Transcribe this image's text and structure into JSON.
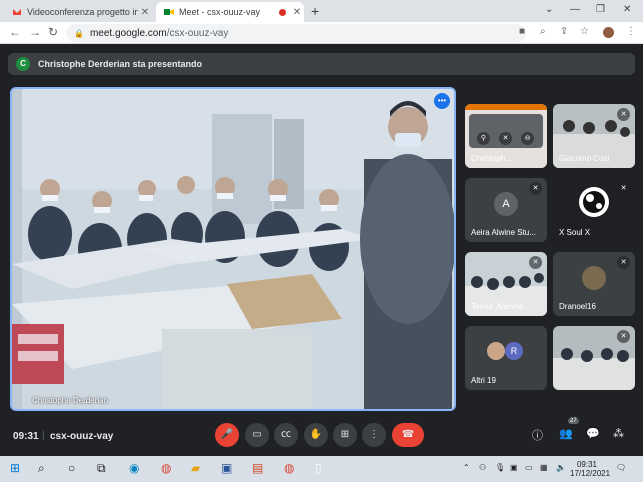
{
  "browser": {
    "tabs": [
      {
        "title": "Videoconferenza progetto interc",
        "favicon": "gmail-icon"
      },
      {
        "title": "Meet - csx-ouuz-vay",
        "favicon": "meet-icon",
        "recording": true
      }
    ],
    "url_host": "meet.google.com",
    "url_path": "/csx-ouuz-vay"
  },
  "meet": {
    "presenter_initial": "C",
    "presenter_banner": "Christophe Derderian sta presentando",
    "main_label": "Christophe Derderian",
    "tiles": [
      {
        "name": "Christoph...",
        "type": "video"
      },
      {
        "name": "Giacomo Cosi",
        "type": "video"
      },
      {
        "name": "Aeira Alwine Stu...",
        "type": "avatar",
        "initial": "A",
        "color": "#5f6368"
      },
      {
        "name": "X Soul X",
        "type": "logo"
      },
      {
        "name": "Temur Jvarshe...",
        "type": "video"
      },
      {
        "name": "Dranoel16",
        "type": "avatar-image"
      },
      {
        "name": "Altri 19",
        "type": "others",
        "initial": "R"
      },
      {
        "name": "",
        "type": "video"
      }
    ],
    "clock": "09:31",
    "separator": "|",
    "meeting_code": "csx-ouuz-vay",
    "participants_count": "27"
  },
  "taskbar": {
    "time": "09:31",
    "date": "17/12/2021"
  },
  "colors": {
    "accent": "#8ab4f8",
    "end_call": "#ea4335",
    "background": "#202124"
  }
}
